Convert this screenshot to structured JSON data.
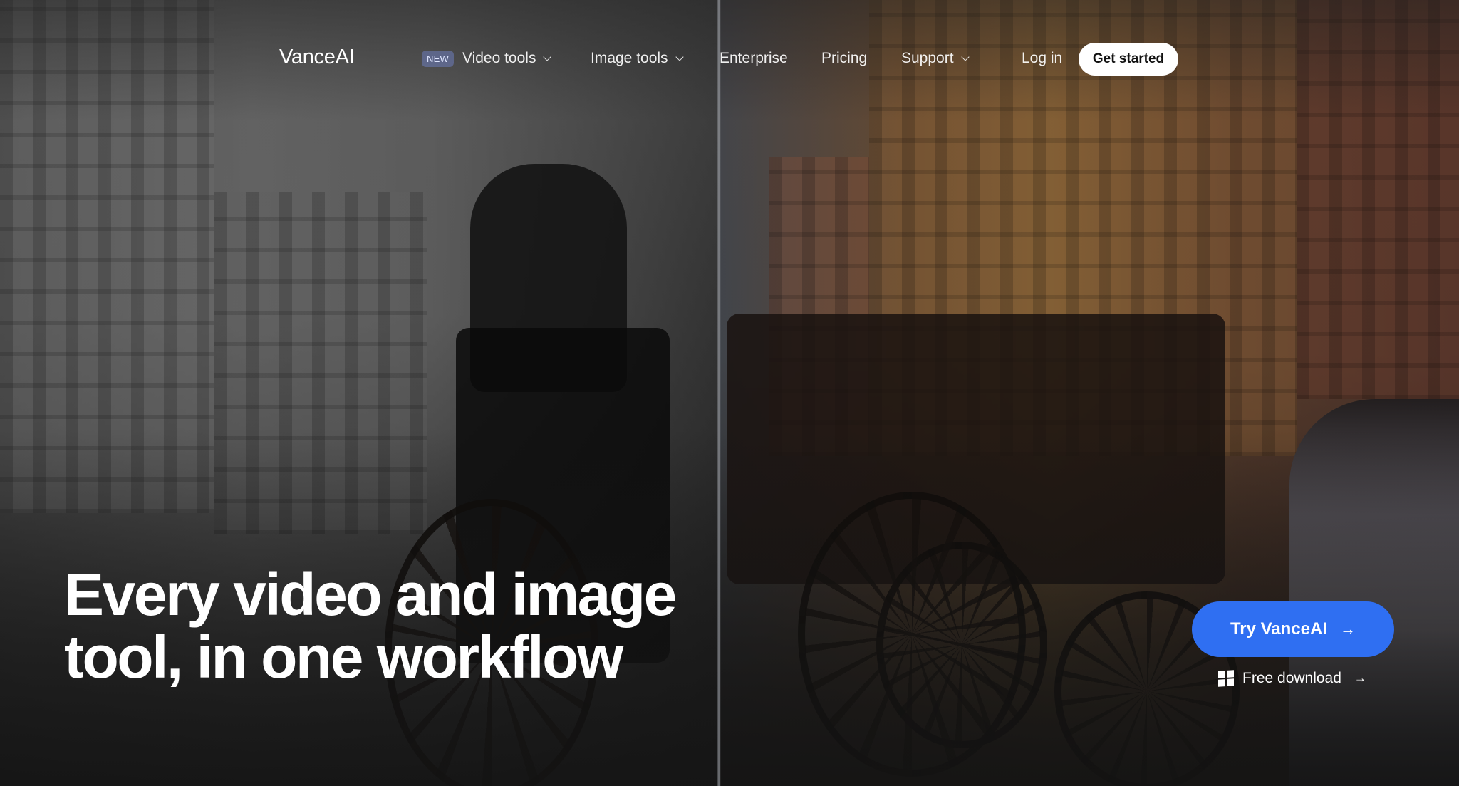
{
  "brand": {
    "logo_text": "VanceAI"
  },
  "nav": {
    "video_tools": {
      "badge": "NEW",
      "label": "Video tools"
    },
    "image_tools": {
      "label": "Image tools"
    },
    "enterprise": {
      "label": "Enterprise"
    },
    "pricing": {
      "label": "Pricing"
    },
    "support": {
      "label": "Support"
    },
    "login": {
      "label": "Log in"
    },
    "get_started": {
      "label": "Get started"
    }
  },
  "hero": {
    "headline_line1": "Every video and image",
    "headline_line2": "tool, in one workflow"
  },
  "cta": {
    "primary_label": "Try VanceAI",
    "primary_arrow": "→",
    "secondary_label": "Free download",
    "secondary_arrow": "→",
    "primary_color": "#2f6ff2"
  },
  "icons": {
    "windows": "windows-icon",
    "chevron": "chevron-down-icon",
    "arrow": "arrow-right-icon"
  }
}
